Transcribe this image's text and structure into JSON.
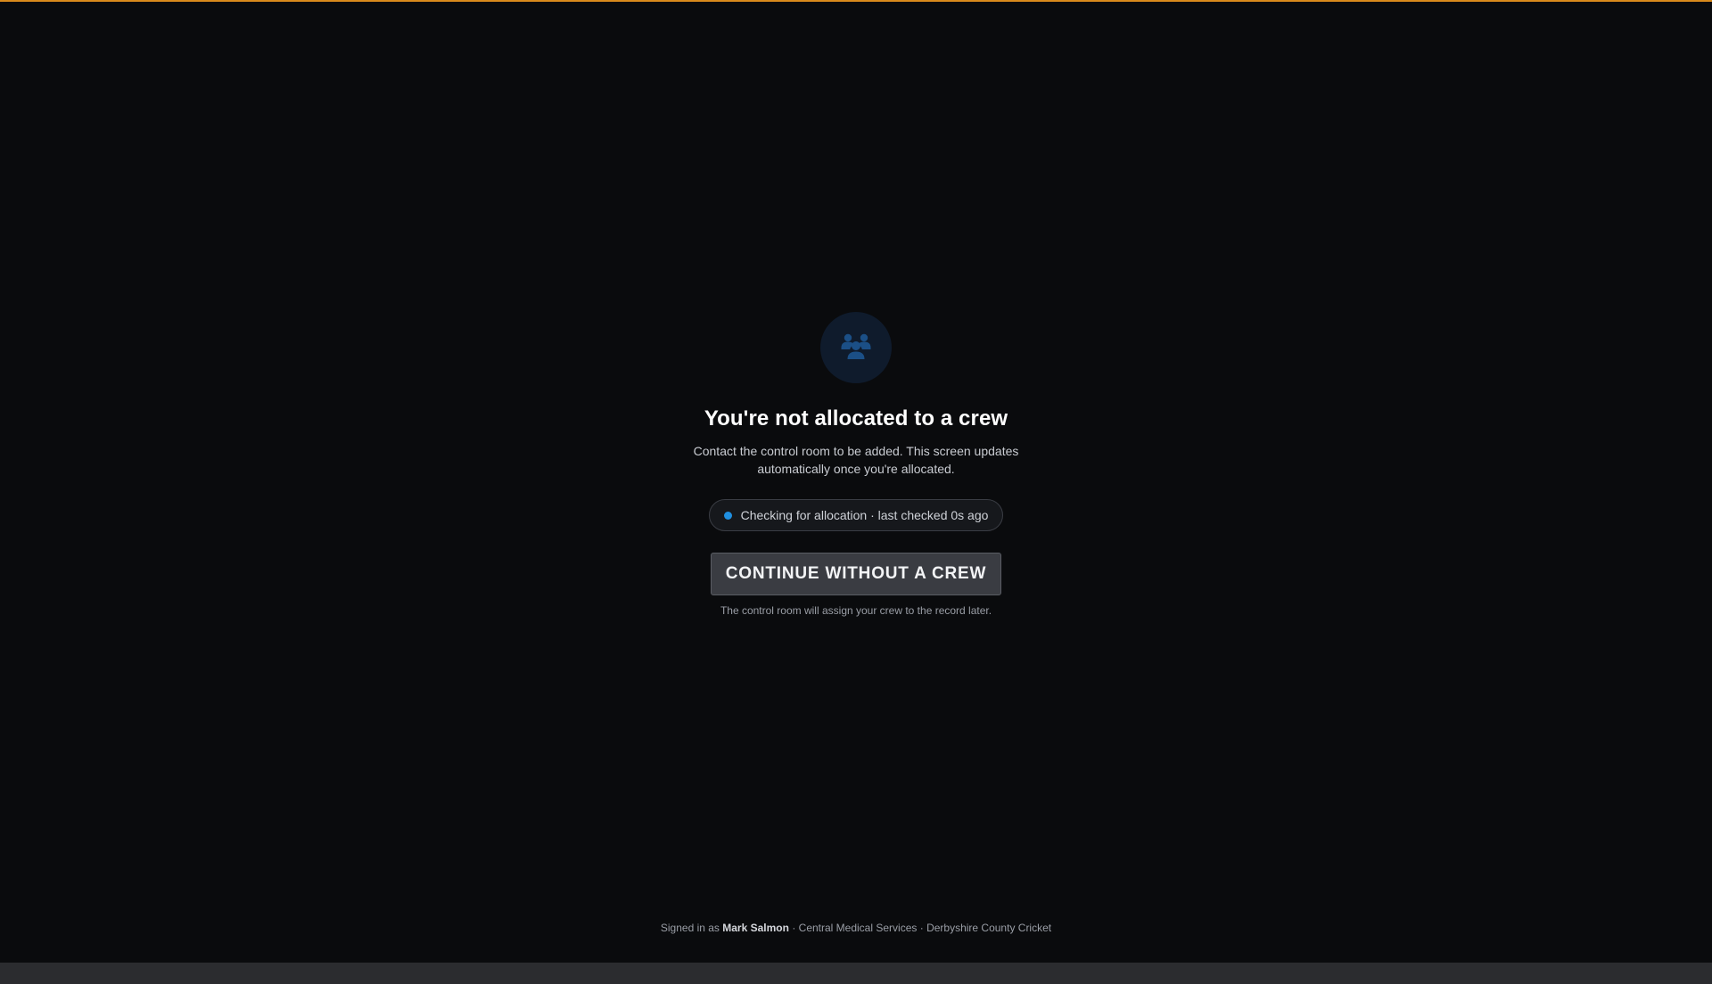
{
  "page": {
    "title": "You're not allocated to a crew",
    "subtitle": "Contact the control room to be added. This screen updates automatically once you're allocated.",
    "icon": "crew-group-icon",
    "accent_color": "#d98a1c",
    "status_dot_color": "#1f8fe0"
  },
  "status": {
    "text": "Checking for allocation · last checked 0s ago"
  },
  "actions": {
    "continue_label": "CONTINUE WITHOUT A CREW",
    "helper": "The control room will assign your crew to the record later."
  },
  "footer": {
    "prefix": "Signed in as",
    "user": "Mark Salmon",
    "org": "Central Medical Services",
    "venue": "Derbyshire County Cricket",
    "separator": "·"
  }
}
